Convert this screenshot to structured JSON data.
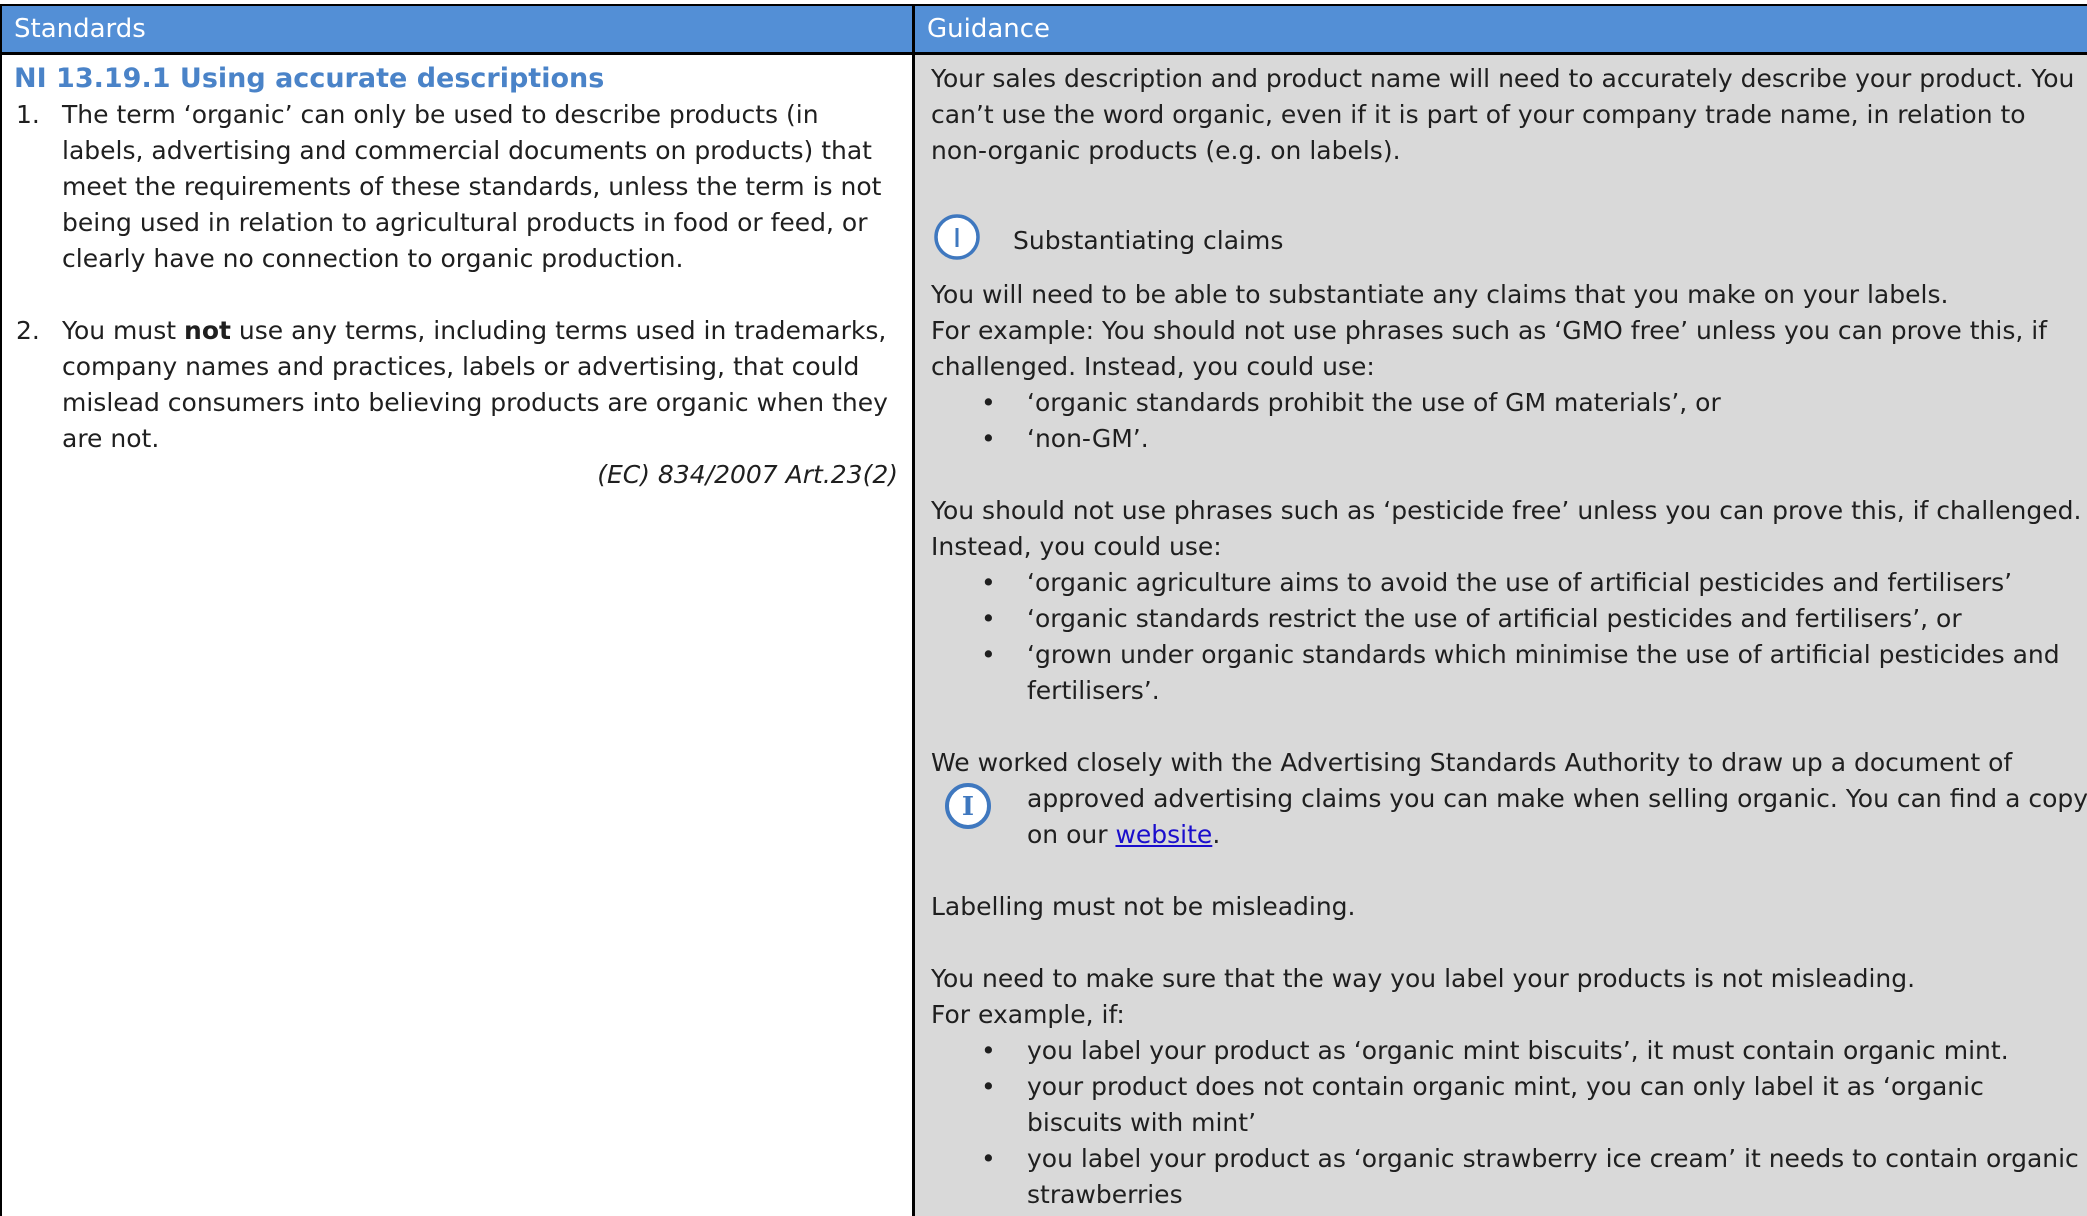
{
  "headers": {
    "standards": "Standards",
    "guidance": "Guidance"
  },
  "standard": {
    "title": "NI 13.19.1 Using accurate descriptions",
    "items": [
      {
        "num": "1.",
        "text": "The term ‘organic’ can only be used to describe products (in labels, advertising and commercial documents on products) that meet the requirements of these standards, unless the term is not being used in relation to agricultural products in food or feed, or clearly have no connection to organic production."
      },
      {
        "num": "2.",
        "pre": "You must ",
        "bold": "not",
        "post": " use any terms, including terms used in trademarks, company names and practices, labels or advertising, that could mislead consumers into believing products are organic when they are not."
      }
    ],
    "citation": "(EC) 834/2007 Art.23(2)"
  },
  "guidance": {
    "intro": "Your sales description and product name will need to accurately describe your product. You can’t use the word organic, even if it is part of your company trade name, in relation to non-organic products (e.g. on labels).",
    "substantiating_title": "Substantiating claims",
    "substantiate_1": "You will need to be able to substantiate any claims that you make on your labels.",
    "substantiate_2": "For example: You should not use phrases such as ‘GMO free’ unless you can prove this, if challenged. Instead, you could use:",
    "gmo_bullets": [
      "‘organic standards prohibit the use of GM materials’, or",
      "‘non-GM’."
    ],
    "pesticide_intro": "You should not use phrases such as ‘pesticide free’ unless you can prove this, if challenged. Instead, you could use:",
    "pesticide_bullets": [
      "‘organic agriculture aims to avoid the use of artificial pesticides and fertilisers’",
      "‘organic standards restrict the use of artificial pesticides and fertilisers’, or",
      "‘grown under organic standards which minimise the use of artificial pesticides and fertilisers’."
    ],
    "asa_line1": "We worked closely with the Advertising Standards Authority to draw up a document of",
    "asa_line2": "approved advertising claims you can make when selling organic.   You can find a copy on our ",
    "asa_link": "website",
    "asa_end": ".",
    "misleading_title": "Labelling must not be misleading.",
    "misleading_1": "You need to make sure that the way you label your products is not misleading.",
    "misleading_2": "For example, if:",
    "mint_bullets": [
      "you label your product as ‘organic mint biscuits’, it must contain organic mint.",
      "your product does not contain organic mint, you can only label it as ‘organic biscuits with mint’",
      "you label your product as ‘organic strawberry ice cream’ it needs to contain organic strawberries"
    ]
  },
  "icons": {
    "info_outline": "info-icon",
    "info_letter": "info-circle-icon"
  },
  "colors": {
    "header_bg": "#538fd6",
    "title": "#4a83c8",
    "guidance_bg": "#d9d9d9",
    "icon": "#3f78bf",
    "link": "#1a0dcc"
  }
}
